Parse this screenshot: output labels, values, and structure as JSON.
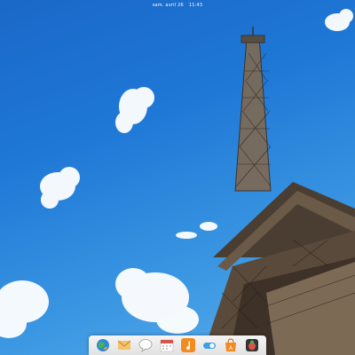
{
  "topbar": {
    "date": "sam. avril 26",
    "time": "11:43"
  },
  "wallpaper": {
    "subject": "Eiffel Tower against blue sky with clouds",
    "sky_color": "#1f78d6"
  },
  "dock": {
    "items": [
      {
        "icon": "browser-globe-icon",
        "color": "#4caf50"
      },
      {
        "icon": "mail-envelope-icon",
        "color": "#f0a030"
      },
      {
        "icon": "chat-bubble-icon",
        "color": "#ffffff"
      },
      {
        "icon": "calendar-icon",
        "color": "#d9534f"
      },
      {
        "icon": "music-note-icon",
        "color": "#f58a1f"
      },
      {
        "icon": "settings-toggle-icon",
        "color": "#3aa0e8"
      },
      {
        "icon": "app-center-bag-icon",
        "color": "#f5881f"
      },
      {
        "icon": "bug-report-icon",
        "color": "#333333"
      }
    ]
  }
}
